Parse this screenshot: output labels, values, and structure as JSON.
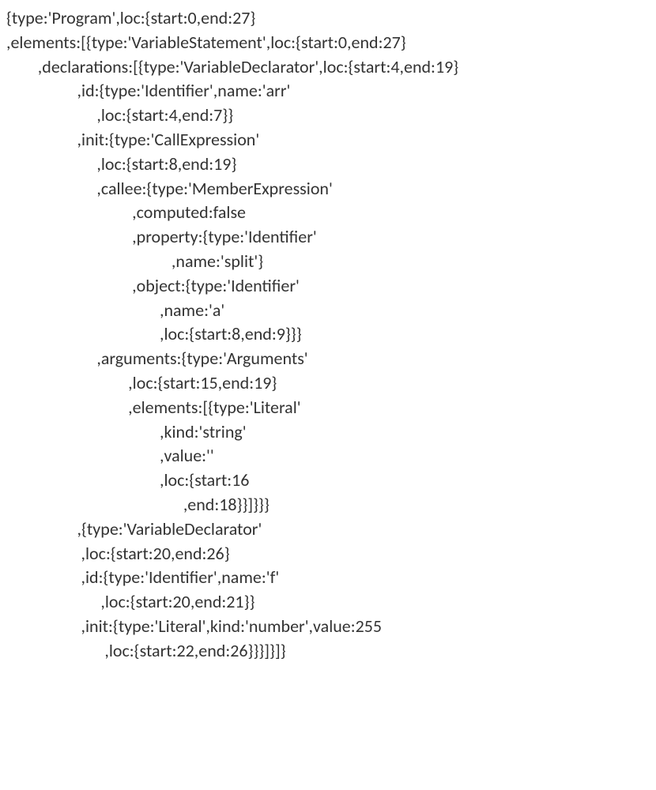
{
  "lines": [
    "{type:'Program',loc:{start:0,end:27}",
    ",elements:[{type:'VariableStatement',loc:{start:0,end:27}",
    "        ,declarations:[{type:'VariableDeclarator',loc:{start:4,end:19}",
    "                  ,id:{type:'Identifier',name:'arr'",
    "                       ,loc:{start:4,end:7}}",
    "                  ,init:{type:'CallExpression'",
    "                       ,loc:{start:8,end:19}",
    "                       ,callee:{type:'MemberExpression'",
    "                                ,computed:false",
    "                                ,property:{type:'Identifier'",
    "                                          ,name:'split'}",
    "                                ,object:{type:'Identifier'",
    "                                       ,name:'a'",
    "                                       ,loc:{start:8,end:9}}}",
    "                       ,arguments:{type:'Arguments'",
    "                               ,loc:{start:15,end:19}",
    "                               ,elements:[{type:'Literal'",
    "                                       ,kind:'string'",
    "                                       ,value:''",
    "                                       ,loc:{start:16",
    "                                             ,end:18}}]}}}",
    "                  ,{type:'VariableDeclarator'",
    "                   ,loc:{start:20,end:26}",
    "                   ,id:{type:'Identifier',name:'f'",
    "                        ,loc:{start:20,end:21}}",
    "                   ,init:{type:'Literal',kind:'number',value:255",
    "                         ,loc:{start:22,end:26}}}]}]}"
  ]
}
